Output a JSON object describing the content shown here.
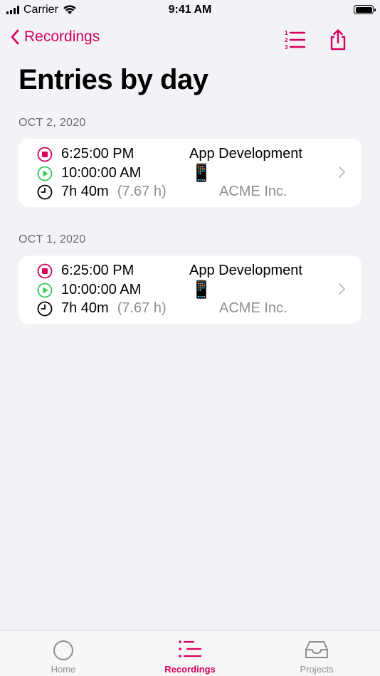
{
  "status_bar": {
    "carrier": "Carrier",
    "time": "9:41 AM"
  },
  "nav": {
    "back_label": "Recordings",
    "list_icon": "numbered-list-icon",
    "share_icon": "share-icon"
  },
  "page_title": "Entries by day",
  "sections": [
    {
      "date": "OCT 2, 2020",
      "entry": {
        "end_time": "6:25:00 PM",
        "start_time": "10:00:00 AM",
        "duration": "7h 40m",
        "duration_hours": "(7.67 h)",
        "project": "App Development",
        "project_emoji": "📱",
        "client": "ACME Inc."
      }
    },
    {
      "date": "OCT 1, 2020",
      "entry": {
        "end_time": "6:25:00 PM",
        "start_time": "10:00:00 AM",
        "duration": "7h 40m",
        "duration_hours": "(7.67 h)",
        "project": "App Development",
        "project_emoji": "📱",
        "client": "ACME Inc."
      }
    }
  ],
  "tabs": [
    {
      "label": "Home",
      "icon": "circle-icon",
      "active": false
    },
    {
      "label": "Recordings",
      "icon": "list-icon",
      "active": true
    },
    {
      "label": "Projects",
      "icon": "tray-icon",
      "active": false
    }
  ],
  "colors": {
    "accent": "#d6005a",
    "start_green": "#34c759",
    "background": "#f2f2f7",
    "secondary_text": "#8e8e93"
  }
}
